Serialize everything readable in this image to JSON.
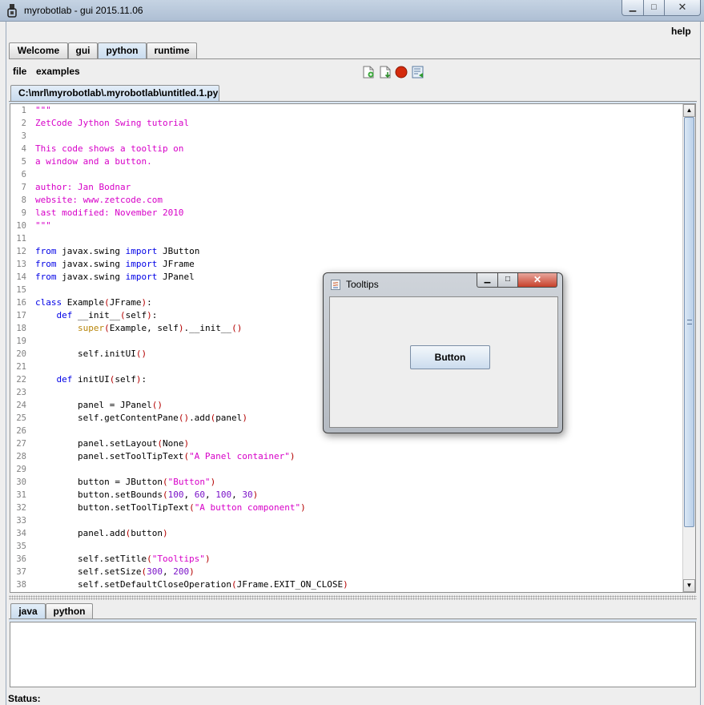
{
  "window": {
    "title": "myrobotlab - gui 2015.11.06",
    "minimize_glyph": "▁",
    "maximize_glyph": "□",
    "close_glyph": "✕"
  },
  "menu": {
    "help": "help"
  },
  "main_tabs": [
    {
      "label": "Welcome"
    },
    {
      "label": "gui"
    },
    {
      "label": "python",
      "selected": true
    },
    {
      "label": "runtime"
    }
  ],
  "python_menu": {
    "file": "file",
    "examples": "examples"
  },
  "toolbar": {
    "icons": [
      "new-file-icon",
      "save-file-icon",
      "stop-icon",
      "run-icon"
    ],
    "stop_color": "#d42a0c"
  },
  "file_tab": {
    "label": "C:\\mrl\\myrobotlab\\.myrobotlab\\untitled.1.py"
  },
  "editor": {
    "line_numbers": [
      "1",
      "2",
      "3",
      "4",
      "5",
      "6",
      "7",
      "8",
      "9",
      "10",
      "11",
      "12",
      "13",
      "14",
      "15",
      "16",
      "17",
      "18",
      "19",
      "20",
      "21",
      "22",
      "23",
      "24",
      "25",
      "26",
      "27",
      "28",
      "29",
      "30",
      "31",
      "32",
      "33",
      "34",
      "35",
      "36",
      "37",
      "38"
    ],
    "lines": [
      "\"\"\"",
      "ZetCode Jython Swing tutorial",
      "",
      "This code shows a tooltip on",
      "a window and a button.",
      "",
      "author: Jan Bodnar",
      "website: www.zetcode.com",
      "last modified: November 2010",
      "\"\"\"",
      "",
      "from javax.swing import JButton",
      "from javax.swing import JFrame",
      "from javax.swing import JPanel",
      "",
      "class Example(JFrame):",
      "    def __init__(self):",
      "        super(Example, self).__init__()",
      "",
      "        self.initUI()",
      "",
      "    def initUI(self):",
      "",
      "        panel = JPanel()",
      "        self.getContentPane().add(panel)",
      "",
      "        panel.setLayout(None)",
      "        panel.setToolTipText(\"A Panel container\")",
      "",
      "        button = JButton(\"Button\")",
      "        button.setBounds(100, 60, 100, 30)",
      "        button.setToolTipText(\"A button component\")",
      "",
      "        panel.add(button)",
      "",
      "        self.setTitle(\"Tooltips\")",
      "        self.setSize(300, 200)",
      "        self.setDefaultCloseOperation(JFrame.EXIT_ON_CLOSE)"
    ],
    "scroll": {
      "up": "▲",
      "down": "▼"
    }
  },
  "bottom_tabs": [
    {
      "label": "java",
      "selected": true
    },
    {
      "label": "python"
    }
  ],
  "status": {
    "label": "Status:"
  },
  "dialog": {
    "title": "Tooltips",
    "button_label": "Button",
    "minimize_glyph": "▁",
    "maximize_glyph": "□",
    "close_glyph": "✕"
  }
}
